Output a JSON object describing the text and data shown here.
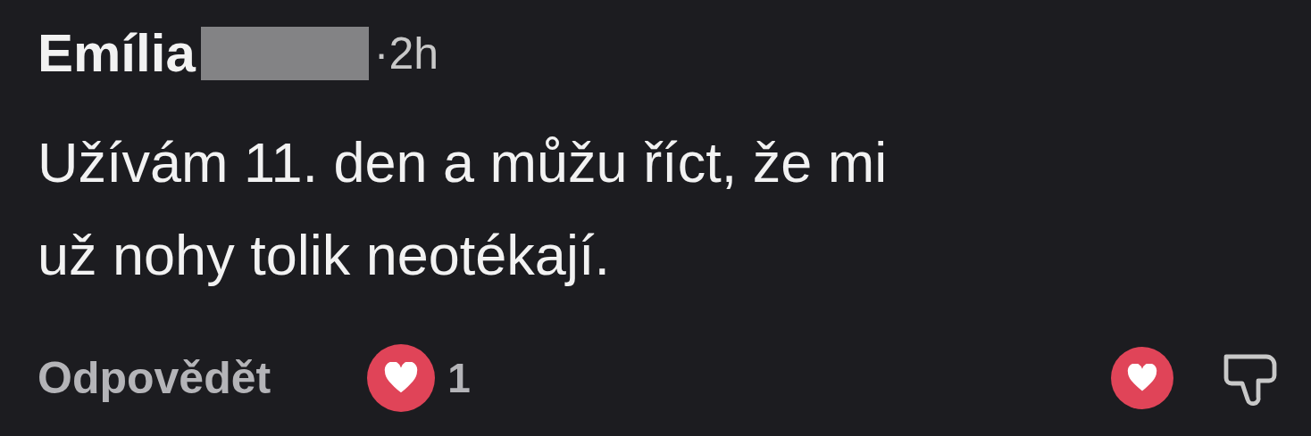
{
  "comment": {
    "author": "Emília",
    "author_redacted": true,
    "time": "·2h",
    "text": "Užívám 11. den a můžu říct, že mi už nohy tolik neotékají.",
    "reply_label": "Odpovědět",
    "reactions_count": "1",
    "liked": true,
    "disliked": false
  }
}
